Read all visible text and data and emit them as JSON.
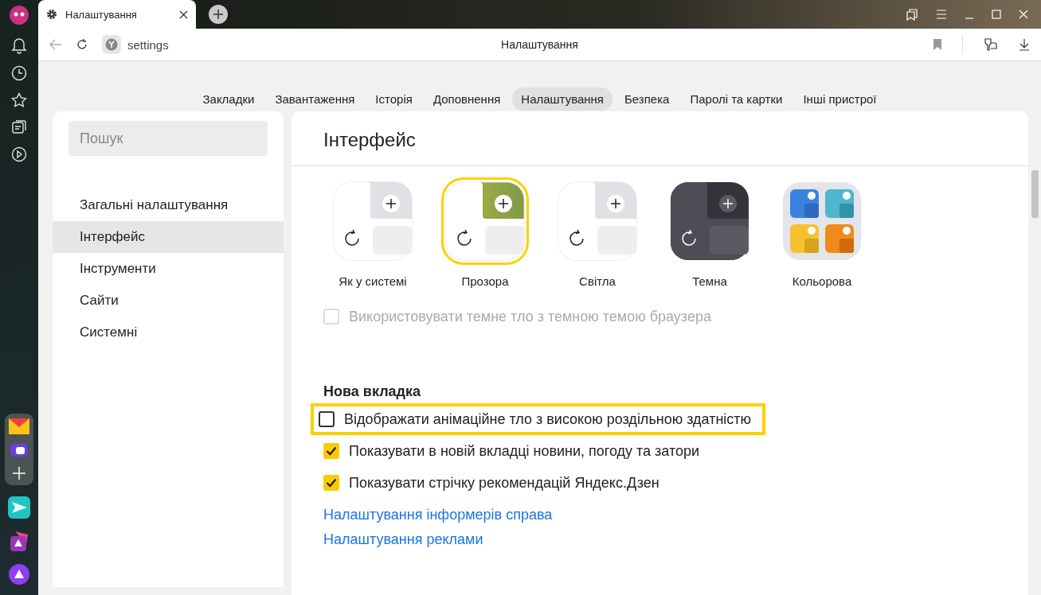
{
  "browser_tab": {
    "title": "Налаштування"
  },
  "address_bar": {
    "url": "settings",
    "page_title": "Налаштування"
  },
  "nav_tabs": [
    {
      "label": "Закладки",
      "selected": false
    },
    {
      "label": "Завантаження",
      "selected": false
    },
    {
      "label": "Історія",
      "selected": false
    },
    {
      "label": "Доповнення",
      "selected": false
    },
    {
      "label": "Налаштування",
      "selected": true
    },
    {
      "label": "Безпека",
      "selected": false
    },
    {
      "label": "Паролі та картки",
      "selected": false
    },
    {
      "label": "Інші пристрої",
      "selected": false
    }
  ],
  "sidebar": {
    "search_placeholder": "Пошук",
    "items": [
      {
        "label": "Загальні налаштування",
        "selected": false
      },
      {
        "label": "Інтерфейс",
        "selected": true
      },
      {
        "label": "Інструменти",
        "selected": false
      },
      {
        "label": "Сайти",
        "selected": false
      },
      {
        "label": "Системні",
        "selected": false
      }
    ]
  },
  "interface": {
    "title": "Інтерфейс",
    "themes": [
      {
        "label": "Як у системі",
        "kind": "system",
        "selected": false
      },
      {
        "label": "Прозора",
        "kind": "transparent",
        "selected": true
      },
      {
        "label": "Світла",
        "kind": "light",
        "selected": false
      },
      {
        "label": "Темна",
        "kind": "dark",
        "selected": false
      },
      {
        "label": "Кольорова",
        "kind": "colored",
        "selected": false
      }
    ],
    "dark_background": {
      "label": "Використовувати темне тло з темною темою браузера",
      "checked": false,
      "disabled": true
    }
  },
  "new_tab": {
    "title": "Нова вкладка",
    "options": [
      {
        "label": "Відображати анімаційне тло з високою роздільною здатністю",
        "checked": false,
        "highlighted": true
      },
      {
        "label": "Показувати в новій вкладці новини, погоду та затори",
        "checked": true,
        "highlighted": false
      },
      {
        "label": "Показувати стрічку рекомендацій Яндекс.Дзен",
        "checked": true,
        "highlighted": false
      }
    ],
    "links": [
      "Налаштування інформерів справа",
      "Налаштування реклами"
    ]
  }
}
